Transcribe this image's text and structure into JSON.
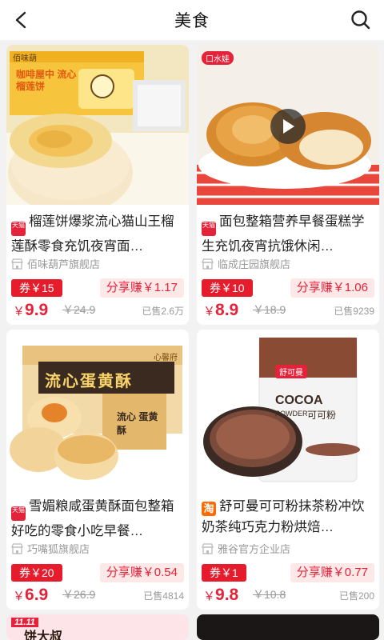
{
  "header": {
    "title": "美食",
    "back_icon": "chevron-left-icon",
    "search_icon": "search-icon"
  },
  "products": [
    {
      "platform": "tmall",
      "badge_text": "天猫",
      "name": "榴莲饼爆浆流心猫山王榴莲酥零食充饥夜宵面…",
      "shop": "佰味葫芦旗舰店",
      "coupon": "券￥15",
      "share": "分享赚￥1.17",
      "price_symbol": "￥",
      "price": "9.9",
      "original_price": "￥24.9",
      "sold": "已售2.6万",
      "image_brand": "佰味葫",
      "image_box_text": "咖啡屋中 流心榴莲饼"
    },
    {
      "platform": "tmall",
      "badge_text": "天猫",
      "name": "面包整箱营养早餐蛋糕学生充饥夜宵抗饿休闲…",
      "shop": "临成庄园旗舰店",
      "coupon": "券￥10",
      "share": "分享赚￥1.06",
      "price_symbol": "￥",
      "price": "8.9",
      "original_price": "￥18.9",
      "sold": "已售9239",
      "image_brand": "口水娃",
      "has_video": true
    },
    {
      "platform": "tmall",
      "badge_text": "天猫",
      "name": "雪媚粮咸蛋黄酥面包整箱好吃的零食小吃早餐…",
      "shop": "巧嘴狐旗舰店",
      "coupon": "券￥20",
      "share": "分享赚￥0.54",
      "price_symbol": "￥",
      "price": "6.9",
      "original_price": "￥26.9",
      "sold": "已售4814",
      "image_brand": "心馨府",
      "image_box_text": "流心蛋黄酥",
      "image_side_text": "流心 蛋黄酥"
    },
    {
      "platform": "taobao",
      "badge_text": "淘",
      "name": "舒可曼可可粉抹茶粉冲饮奶茶纯巧克力粉烘焙…",
      "shop": "雅谷官方企业店",
      "coupon": "券￥1",
      "share": "分享赚￥0.77",
      "price_symbol": "￥",
      "price": "9.8",
      "original_price": "￥10.8",
      "sold": "已售200",
      "image_brand": "舒可曼",
      "image_pack_title": "COCOA",
      "image_pack_sub": "POWDER",
      "image_pack_cn": "可可粉"
    }
  ],
  "peek": {
    "left_tag": "11.11",
    "left_text": "饼大叔"
  },
  "colors": {
    "accent": "#e4223a",
    "coupon_bg": "#e61c2c",
    "share_bg": "#fde8e8",
    "page_bg": "#f2f2f2"
  }
}
